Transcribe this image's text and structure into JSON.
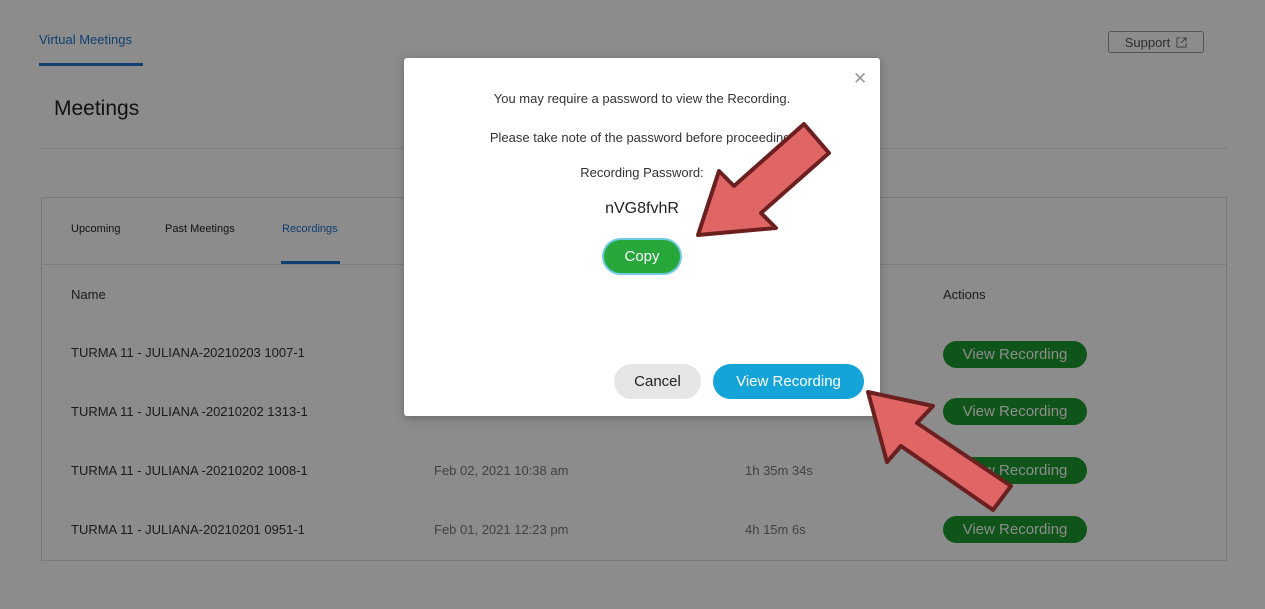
{
  "header": {
    "nav_tab": "Virtual Meetings",
    "support_label": "Support",
    "support_icon": "external-link-icon"
  },
  "page": {
    "title": "Meetings"
  },
  "tabs": [
    {
      "label": "Upcoming",
      "active": false
    },
    {
      "label": "Past Meetings",
      "active": false
    },
    {
      "label": "Recordings",
      "active": true
    }
  ],
  "table": {
    "columns": {
      "name": "Name",
      "actions": "Actions"
    },
    "rows": [
      {
        "name": "TURMA 11 - JULIANA-20210203 1007-1",
        "date": "",
        "duration": "",
        "action": "View Recording"
      },
      {
        "name": "TURMA 11 - JULIANA -20210202 1313-1",
        "date": "",
        "duration": "",
        "action": "View Recording"
      },
      {
        "name": "TURMA 11 - JULIANA -20210202 1008-1",
        "date": "Feb 02, 2021 10:38 am",
        "duration": "1h 35m 34s",
        "action": "View Recording"
      },
      {
        "name": "TURMA 11 - JULIANA-20210201 0951-1",
        "date": "Feb 01, 2021 12:23 pm",
        "duration": "4h 15m 6s",
        "action": "View Recording"
      }
    ]
  },
  "modal": {
    "line1": "You may require a password to view the Recording.",
    "line2": "Please take note of the password before proceeding.",
    "password_label": "Recording Password:",
    "password": "nVG8fvhR",
    "copy_label": "Copy",
    "cancel_label": "Cancel",
    "view_label": "View Recording",
    "close_icon": "close-icon"
  },
  "colors": {
    "accent": "#1a73c8",
    "green": "#1d9a2c",
    "view_button": "#14a4d8",
    "annotation_arrow": "#e06666"
  }
}
